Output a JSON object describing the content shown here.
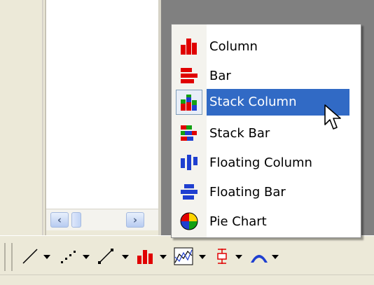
{
  "menu": {
    "items": [
      {
        "label": "Column",
        "icon": "column-chart-icon"
      },
      {
        "label": "Bar",
        "icon": "bar-chart-icon"
      },
      {
        "label": "Stack Column",
        "icon": "stack-column-chart-icon",
        "selected": true
      },
      {
        "label": "Stack Bar",
        "icon": "stack-bar-chart-icon"
      },
      {
        "label": "Floating Column",
        "icon": "floating-column-chart-icon"
      },
      {
        "label": "Floating Bar",
        "icon": "floating-bar-chart-icon"
      },
      {
        "label": "Pie Chart",
        "icon": "pie-chart-icon"
      }
    ]
  },
  "toolbar": {
    "tools": [
      "line-tool-icon",
      "dotted-line-tool-icon",
      "scatter-line-tool-icon",
      "column-chart-icon",
      "area-chart-icon",
      "error-bar-icon",
      "curve-tool-icon"
    ]
  },
  "colors": {
    "selection": "#316ac5",
    "red": "#e00000",
    "blue": "#1f3fd0",
    "green": "#12a012"
  }
}
